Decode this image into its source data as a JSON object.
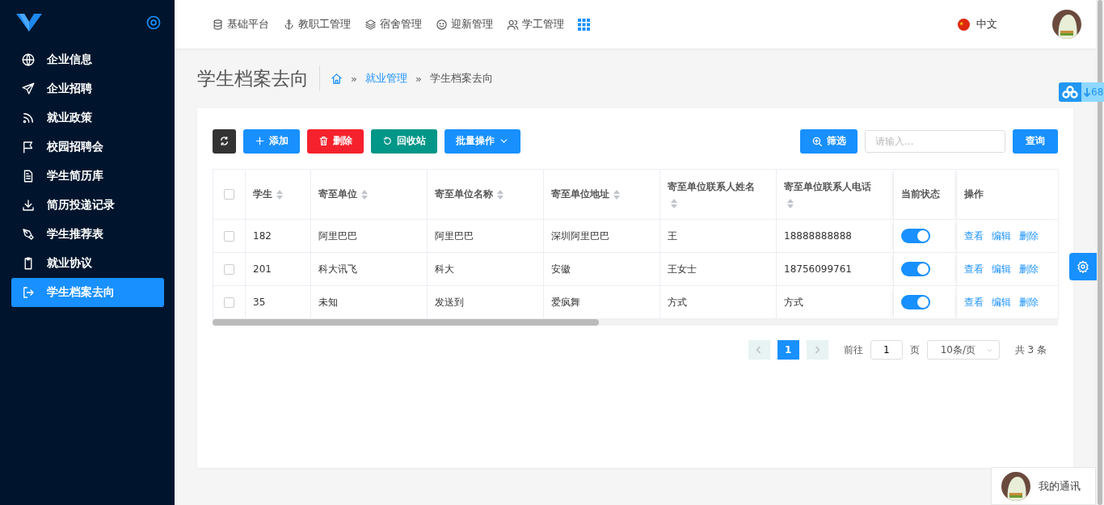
{
  "sidebar": {
    "items": [
      {
        "label": "企业信息",
        "selected": false
      },
      {
        "label": "企业招聘",
        "selected": false
      },
      {
        "label": "就业政策",
        "selected": false
      },
      {
        "label": "校园招聘会",
        "selected": false
      },
      {
        "label": "学生简历库",
        "selected": false
      },
      {
        "label": "简历投递记录",
        "selected": false
      },
      {
        "label": "学生推荐表",
        "selected": false
      },
      {
        "label": "就业协议",
        "selected": false
      },
      {
        "label": "学生档案去向",
        "selected": true
      }
    ]
  },
  "topnav": {
    "items": [
      {
        "label": "基础平台"
      },
      {
        "label": "教职工管理"
      },
      {
        "label": "宿舍管理"
      },
      {
        "label": "迎新管理"
      },
      {
        "label": "学工管理"
      }
    ],
    "language": "中文"
  },
  "page": {
    "title": "学生档案去向",
    "breadcrumb": [
      {
        "kind": "separator",
        "text": "»"
      },
      {
        "kind": "link",
        "text": "就业管理"
      },
      {
        "kind": "separator",
        "text": "»"
      },
      {
        "kind": "current",
        "text": "学生档案去向"
      }
    ]
  },
  "toolbar": {
    "buttons": [
      {
        "kind": "refresh"
      },
      {
        "kind": "add",
        "label": "添加"
      },
      {
        "kind": "delete",
        "label": "删除"
      },
      {
        "kind": "recycle",
        "label": "回收站"
      },
      {
        "kind": "batch",
        "label": "批量操作"
      }
    ],
    "filter": "筛选",
    "search": {
      "placeholder": "请输入..."
    },
    "query": "查询"
  },
  "table": {
    "select_all": false,
    "columns": [
      {
        "label": "学生",
        "sortable": true
      },
      {
        "label": "寄至单位",
        "sortable": true
      },
      {
        "label": "寄至单位名称",
        "sortable": true
      },
      {
        "label": "寄至单位地址",
        "sortable": true
      },
      {
        "label": "寄至单位联系人姓名",
        "sortable": true
      },
      {
        "label": "寄至单位联系人电话",
        "sortable": true
      },
      {
        "label": "当前状态",
        "sortable": false
      },
      {
        "label": "操作",
        "sortable": false
      }
    ],
    "rows": [
      {
        "checked": false,
        "cells": [
          "182",
          "阿里巴巴",
          "阿里巴巴",
          "深圳阿里巴巴",
          "王",
          "18888888888"
        ],
        "on": true,
        "actions": [
          "查看",
          "编辑",
          "删除"
        ]
      },
      {
        "checked": false,
        "cells": [
          "201",
          "科大讯飞",
          "科大",
          "安徽",
          "王女士",
          "18756099761"
        ],
        "on": true,
        "actions": [
          "查看",
          "编辑",
          "删除"
        ]
      },
      {
        "checked": false,
        "cells": [
          "35",
          "未知",
          "发送到",
          "爱疯舞",
          "方式",
          "方式"
        ],
        "on": true,
        "actions": [
          "查看",
          "编辑",
          "删除"
        ]
      }
    ]
  },
  "pagination": {
    "pages": [
      {
        "label": "1",
        "selected": true
      }
    ],
    "goto_label": "前往",
    "goto_value": "1",
    "page_unit": "页",
    "page_size": "10条/页",
    "total": "共 3 条"
  },
  "widgets": {
    "download_count": "68",
    "chat": "我的通讯"
  }
}
